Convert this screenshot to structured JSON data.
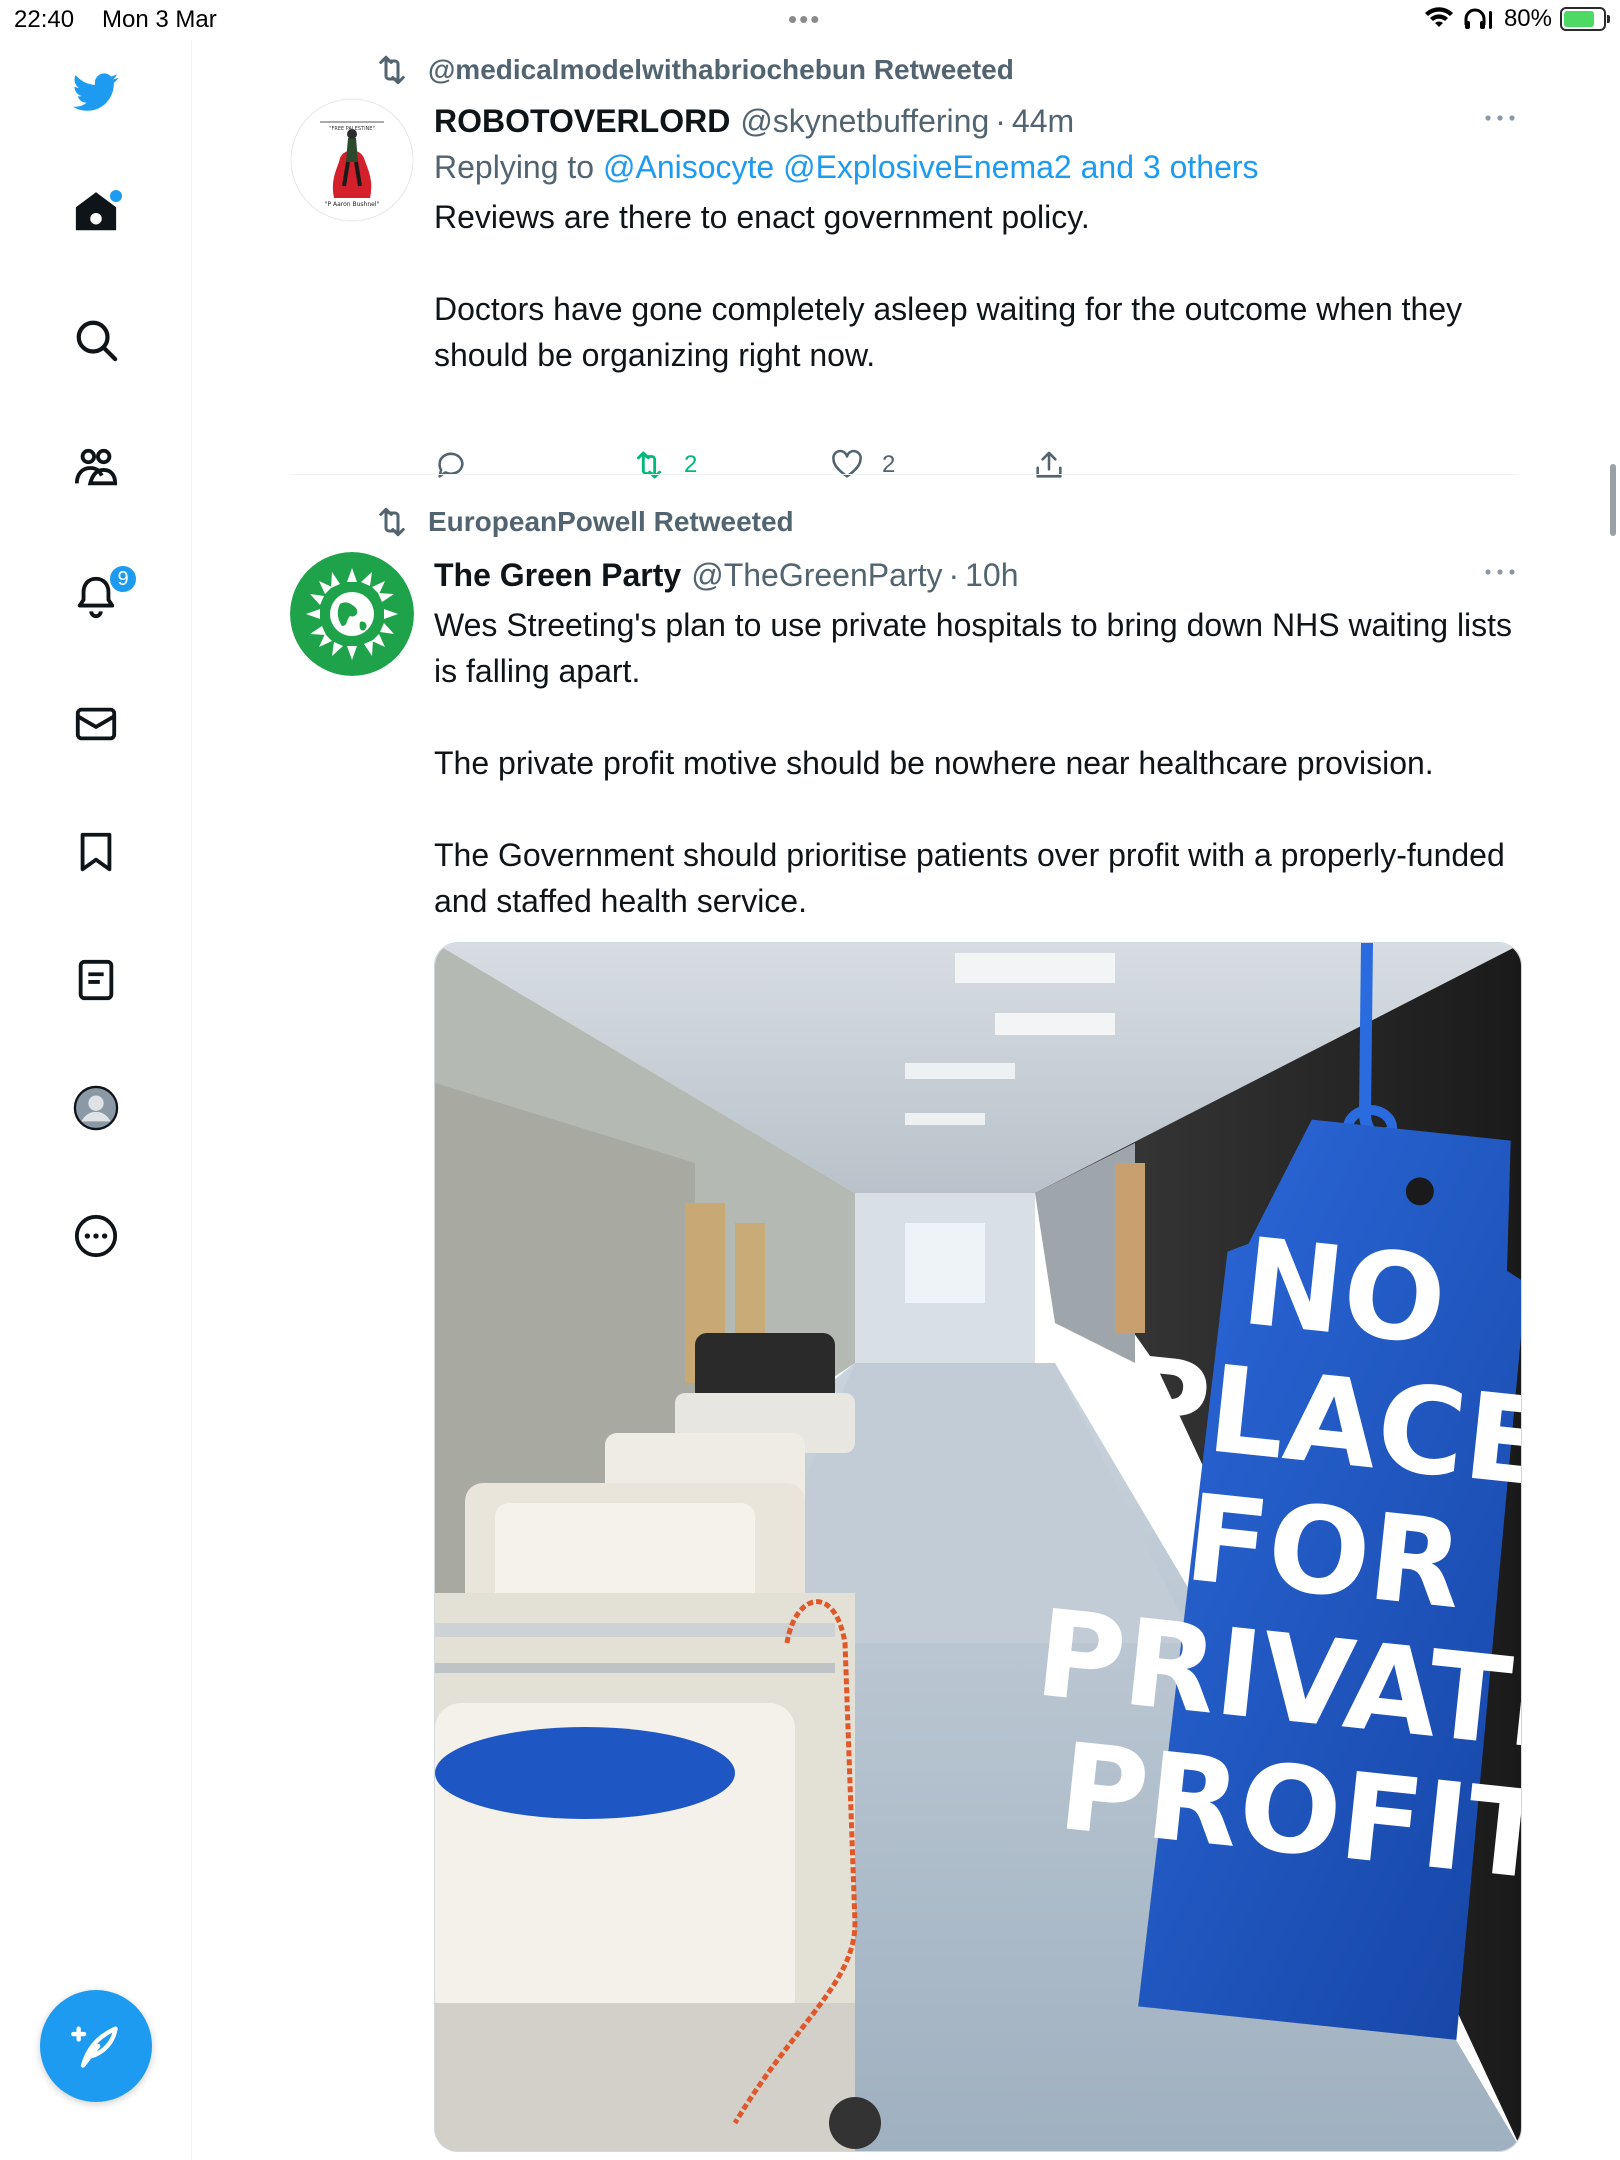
{
  "status_bar": {
    "time": "22:40",
    "date": "Mon 3 Mar",
    "dots": "•••",
    "battery": "80%",
    "battery_level": 0.8
  },
  "sidebar": {
    "items": [
      {
        "name": "twitter-logo",
        "icon": "bird-icon"
      },
      {
        "name": "home",
        "icon": "home-icon",
        "has_dot": true
      },
      {
        "name": "explore",
        "icon": "search-icon"
      },
      {
        "name": "communities",
        "icon": "people-icon"
      },
      {
        "name": "notifications",
        "icon": "bell-icon",
        "badge": "9"
      },
      {
        "name": "messages",
        "icon": "envelope-icon"
      },
      {
        "name": "bookmarks",
        "icon": "bookmark-icon"
      },
      {
        "name": "lists",
        "icon": "list-icon"
      },
      {
        "name": "profile",
        "icon": "avatar-icon"
      },
      {
        "name": "more",
        "icon": "more-circle-icon"
      }
    ],
    "compose_icon": "compose-feather-icon"
  },
  "tweets": [
    {
      "retweeted_by": "@medicalmodelwithabriochebun Retweeted",
      "avatar_caption_top": "\"FREE PALESTINE\"",
      "avatar_caption_bottom": "\"P Aaron Bushnel\"",
      "name": "ROBOTOVERLORD",
      "handle": "@skynetbuffering",
      "separator": "·",
      "time": "44m",
      "replying_prefix": "Replying to",
      "replying_to": "@Anisocyte @ExplosiveEnema2 and 3 others",
      "paragraphs": [
        "Reviews are there to enact government policy.",
        "Doctors have gone completely asleep waiting for the outcome when they should be organizing right now."
      ],
      "retweets": "2",
      "likes": "2"
    },
    {
      "retweeted_by": "EuropeanPowell Retweeted",
      "name": "The Green Party",
      "handle": "@TheGreenParty",
      "separator": "·",
      "time": "10h",
      "paragraphs": [
        "Wes Streeting's plan to use private hospitals to bring down NHS waiting lists is falling apart.",
        "The private profit motive should be nowhere near healthcare provision.",
        "The Government should prioritise patients over profit with a properly-funded and staffed health service."
      ],
      "image_tag_lines": [
        "NO",
        "PLACE",
        "FOR",
        "PRIVATE",
        "PROFIT"
      ]
    }
  ],
  "colors": {
    "accent": "#1d9bf0",
    "retweet_green": "#00ba7c",
    "muted": "#536471",
    "green_party": "#1fa34a",
    "tag_blue": "#1d56c8"
  }
}
